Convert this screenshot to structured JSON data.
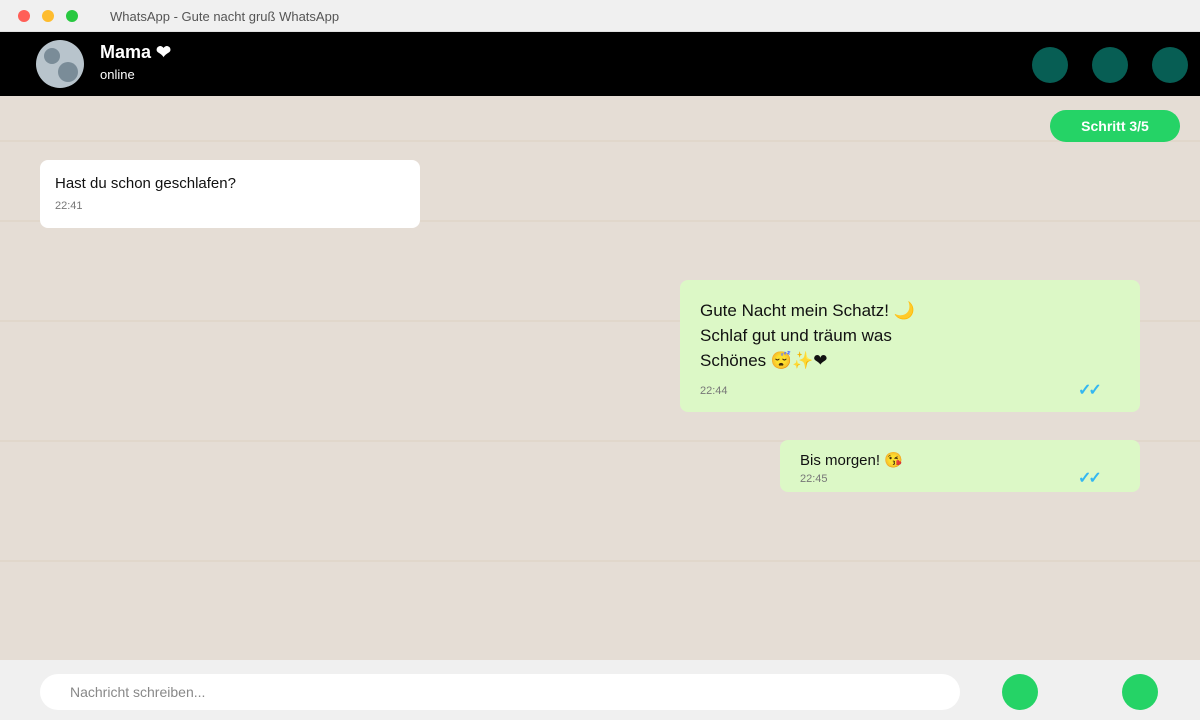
{
  "window": {
    "title": "WhatsApp - Gute nacht gruß WhatsApp"
  },
  "header": {
    "contact_name": "Mama ❤",
    "status": "online",
    "actions": [
      "video-call-icon",
      "voice-call-icon",
      "menu-icon"
    ]
  },
  "chat": {
    "step_label": "Schritt 3/5",
    "messages": [
      {
        "direction": "incoming",
        "text": "Hast du schon geschlafen?",
        "time": "22:41"
      },
      {
        "direction": "outgoing",
        "text": "Gute Nacht mein Schatz! 🌙\nSchlaf gut und träum was\nSchönes 😴✨❤",
        "time": "22:44",
        "ticks": "✓✓"
      },
      {
        "direction": "outgoing",
        "text": "Bis morgen! 😘",
        "time": "22:45",
        "ticks": "✓✓"
      }
    ]
  },
  "composer": {
    "placeholder": "Nachricht schreiben...",
    "actions": [
      "emoji-icon",
      "send-icon"
    ]
  },
  "colors": {
    "header_bg": "#000000",
    "accent": "#25d366",
    "header_button": "#075e54",
    "outgoing_bubble": "#dcf8c6",
    "chat_bg": "#e5ddd5",
    "read_ticks": "#34b7f1"
  }
}
